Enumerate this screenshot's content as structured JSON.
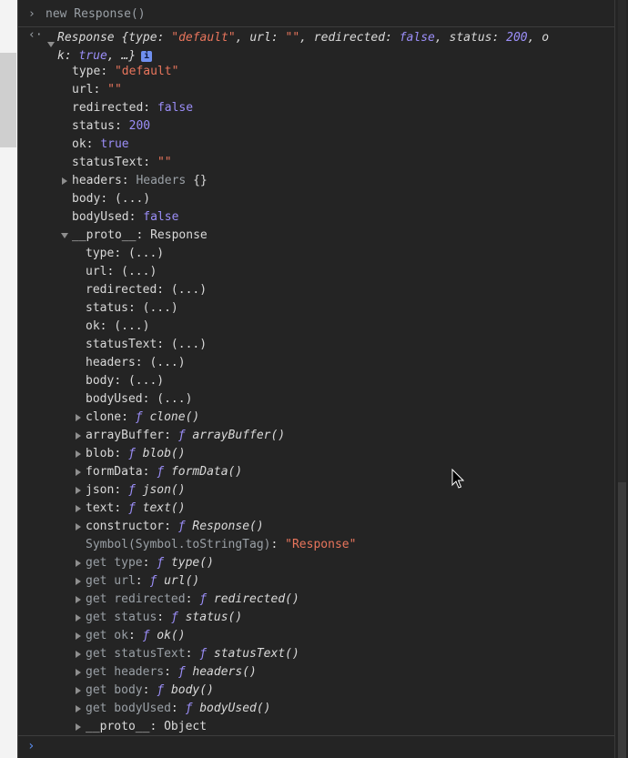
{
  "console": {
    "command": "new Response()",
    "summary": {
      "prefix": "Response {",
      "parts": [
        [
          "type: ",
          "\"default\""
        ],
        [
          ", url: ",
          "\"\""
        ],
        [
          ", redirected: ",
          "false"
        ],
        [
          ", status: ",
          "200"
        ],
        [
          ", o",
          ""
        ]
      ],
      "line2_key": "k: ",
      "line2_val": "true",
      "line2_end": ", …}",
      "info_icon": "i"
    },
    "own_props": [
      {
        "key": "type",
        "value": "\"default\"",
        "kind": "str"
      },
      {
        "key": "url",
        "value": "\"\"",
        "kind": "str"
      },
      {
        "key": "redirected",
        "value": "false",
        "kind": "num"
      },
      {
        "key": "status",
        "value": "200",
        "kind": "num"
      },
      {
        "key": "ok",
        "value": "true",
        "kind": "num"
      },
      {
        "key": "statusText",
        "value": "\"\"",
        "kind": "str"
      },
      {
        "key": "headers",
        "value": "Headers {}",
        "kind": "obj"
      },
      {
        "key": "body",
        "value": "(...)",
        "kind": "val"
      },
      {
        "key": "bodyUsed",
        "value": "false",
        "kind": "num"
      }
    ],
    "proto": {
      "key": "__proto__",
      "value": "Response"
    },
    "proto_lazy": [
      "type",
      "url",
      "redirected",
      "status",
      "ok",
      "statusText",
      "headers",
      "body",
      "bodyUsed"
    ],
    "proto_lazy_value": "(...)",
    "proto_methods": [
      {
        "key": "clone",
        "fn": "clone()"
      },
      {
        "key": "arrayBuffer",
        "fn": "arrayBuffer()"
      },
      {
        "key": "blob",
        "fn": "blob()"
      },
      {
        "key": "formData",
        "fn": "formData()"
      },
      {
        "key": "json",
        "fn": "json()"
      },
      {
        "key": "text",
        "fn": "text()"
      },
      {
        "key": "constructor",
        "fn": "Response()"
      }
    ],
    "symbol": {
      "key": "Symbol(Symbol.toStringTag)",
      "value": "\"Response\""
    },
    "getters": [
      {
        "key": "get type",
        "fn": "type()"
      },
      {
        "key": "get url",
        "fn": "url()"
      },
      {
        "key": "get redirected",
        "fn": "redirected()"
      },
      {
        "key": "get status",
        "fn": "status()"
      },
      {
        "key": "get ok",
        "fn": "ok()"
      },
      {
        "key": "get statusText",
        "fn": "statusText()"
      },
      {
        "key": "get headers",
        "fn": "headers()"
      },
      {
        "key": "get body",
        "fn": "body()"
      },
      {
        "key": "get bodyUsed",
        "fn": "bodyUsed()"
      }
    ],
    "proto2": {
      "key": "__proto__",
      "value": "Object"
    },
    "f_glyph": "ƒ"
  },
  "colors": {
    "background": "#242424",
    "string": "#e8755c",
    "number": "#9b8ef8",
    "text": "#d9d9d9",
    "dim": "#9aa0a6"
  }
}
